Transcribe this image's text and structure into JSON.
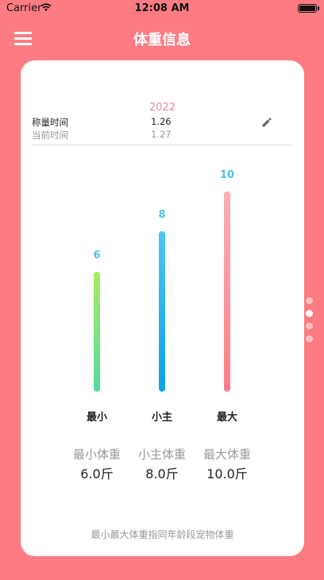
{
  "status_bar": {
    "carrier": "Carrier",
    "time": "12:08 AM"
  },
  "nav": {
    "title": "体重信息",
    "menu_icon": "hamburger-menu-icon"
  },
  "card": {
    "year": "2022",
    "weigh_time_label": "称量时间",
    "weigh_time_value": "1.26",
    "current_time_label": "当前时间",
    "current_time_value": "1.27",
    "edit_icon": "pencil-icon"
  },
  "chart_data": {
    "type": "bar",
    "categories": [
      "最小",
      "小主",
      "最大"
    ],
    "values": [
      6,
      8,
      10
    ],
    "colors": [
      [
        "#a8ec5f",
        "#52dba0"
      ],
      [
        "#4cc6f2",
        "#0ea2e8"
      ],
      [
        "#fcafb4",
        "#fa7d88"
      ]
    ]
  },
  "stats": [
    {
      "title": "最小体重",
      "value": "6.0斤"
    },
    {
      "title": "小主体重",
      "value": "8.0斤"
    },
    {
      "title": "最大体重",
      "value": "10.0斤"
    }
  ],
  "footnote": "最小最大体重指同年龄段宠物体重",
  "page_dots": {
    "count": 4,
    "active_index": 1
  },
  "colors": {
    "background": "#fd7b82",
    "accent_value": "#4fc3e8",
    "year": "#e98b94"
  }
}
